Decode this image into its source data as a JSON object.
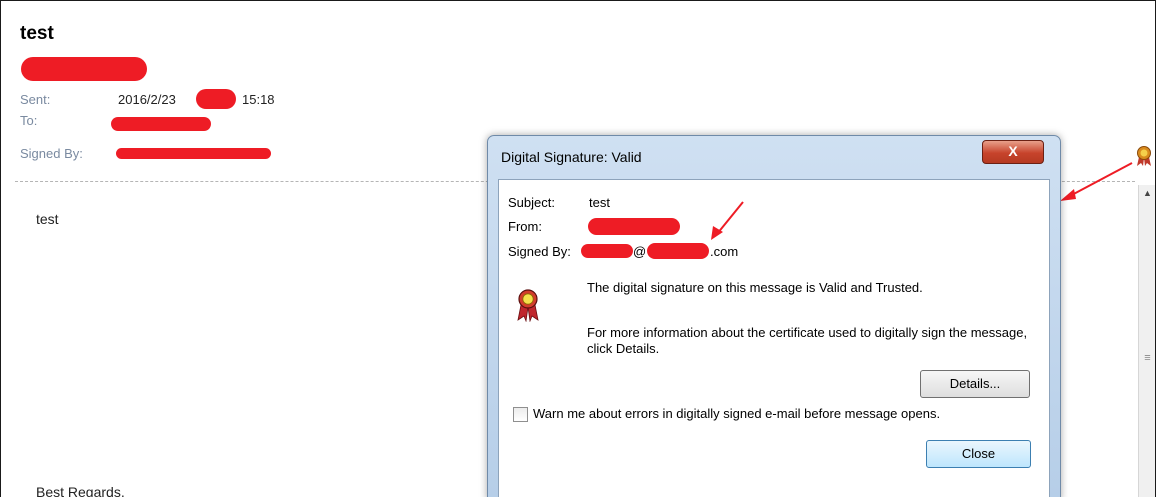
{
  "email": {
    "subject": "test",
    "headers": {
      "sent_label": "Sent:",
      "sent_date": "2016/2/23",
      "sent_time": "15:18",
      "to_label": "To:",
      "signed_by_label": "Signed By:"
    },
    "body": {
      "text": "test",
      "closing": "Best Regards,"
    }
  },
  "dialog": {
    "title": "Digital Signature: Valid",
    "close_glyph": "X",
    "subject_label": "Subject:",
    "subject_value": "test",
    "from_label": "From:",
    "signed_by_label": "Signed By:",
    "signed_by_visible": "@",
    "signed_by_suffix": ".com",
    "status_message": "The digital signature on this message is Valid and Trusted.",
    "info_message": "For more information about the certificate used to digitally sign the message, click Details.",
    "details_button": "Details...",
    "warn_checkbox_label": "Warn me about errors in digitally signed e-mail before message opens.",
    "close_button": "Close"
  },
  "icons": {
    "signature_status": "certificate-ribbon-icon",
    "dialog_status": "certificate-ribbon-icon",
    "scroll_up": "triangle-up-icon"
  },
  "colors": {
    "redaction": "#ee1c25",
    "header_label": "#7a8aa0",
    "dialog_frame": "#b6cee8",
    "close_button_red": "#c7432b"
  }
}
